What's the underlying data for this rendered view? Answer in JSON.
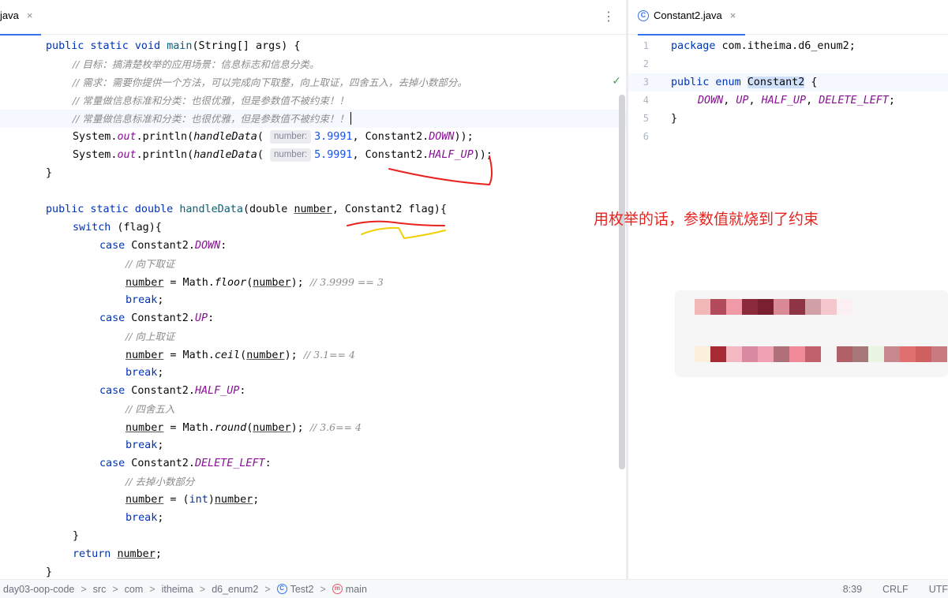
{
  "left_tab": {
    "label": "java",
    "close": "×"
  },
  "right_tab": {
    "label": "Constant2.java",
    "close": "×",
    "icon": "C"
  },
  "more_menu": "⋮",
  "inspection": "✓",
  "left_code": {
    "l1_kw": "public static void",
    "l1_name": "main",
    "l1_rest": "(String[] args) {",
    "c1": "// 目标：搞清楚枚举的应用场景：信息标志和信息分类。",
    "c2": "// 需求：需要你提供一个方法，可以完成向下取整，向上取证，四舍五入，去掉小数部分。",
    "c3": "// 常量做信息标准和分类：也很优雅，但是参数值不被约束！！",
    "c4": "// 常量做信息标准和分类：也很优雅，但是参数值不被约束！！",
    "p1_a": "System.",
    "p1_out": "out",
    "p1_b": ".println(",
    "p1_call": "handleData",
    "p1_c": "(",
    "hint": "number:",
    "p1_num": "3.9991",
    "p1_d": ", Constant2.",
    "p1_const": "DOWN",
    "p1_e": "));",
    "p2_num": "5.9991",
    "p2_const": "HALF_UP",
    "p2_e": "));",
    "brace1": "}",
    "m_kw": "public static double",
    "m_name": "handleData",
    "m_a": "(double ",
    "m_param": "number",
    "m_b": ", Constant2 flag){",
    "sw_kw": "switch",
    "sw_rest": " (flag){",
    "case_kw": "case",
    "case_pre": " Constant2.",
    "k_down": "DOWN",
    "k_up": "UP",
    "k_half": "HALF_UP",
    "k_del": "DELETE_LEFT",
    "colon": ":",
    "cm_down": "// 向下取证",
    "cm_up": "// 向上取证",
    "cm_half": "// 四舍五入",
    "cm_del": "// 去掉小数部分",
    "var": "number",
    "assign_math": " = Math.",
    "floor": "floor",
    "ceil": "ceil",
    "round": "round",
    "call_close": ");",
    "eg_floor": "// 3.9999 == 3",
    "eg_ceil": "// 3.1== 4",
    "eg_round": "// 3.6== 4",
    "assign_int_a": " = (",
    "int_kw": "int",
    "assign_int_b": ")",
    "semi": ";",
    "break_kw": "break",
    "brace2": "}",
    "ret_kw": "return",
    "ret_rest": ";"
  },
  "right_code": {
    "line_numbers": [
      "1",
      "2",
      "3",
      "4",
      "5",
      "6"
    ],
    "pkg_kw": "package",
    "pkg_rest": " com.itheima.d6_enum2;",
    "enum_kw": "public enum",
    "enum_name": "Constant2",
    "enum_brace": " {",
    "c_down": "DOWN",
    "c_up": "UP",
    "c_half": "HALF_UP",
    "c_del": "DELETE_LEFT",
    "comma": ", ",
    "end_semi": ";",
    "close": "}"
  },
  "annotation": "用枚举的话，参数值就烧到了约束",
  "statusbar": {
    "crumbs": [
      "day03-oop-code",
      "src",
      "com",
      "itheima",
      "d6_enum2",
      "Test2",
      "main"
    ],
    "sep": ">",
    "icon_class": "C",
    "icon_method": "m",
    "position": "8:39",
    "line_sep": "CRLF",
    "encoding": "UTF"
  },
  "colors": {
    "accent": "#3574f0",
    "keyword": "#0033b3",
    "constant": "#871094",
    "annotation": "#e8231e",
    "number": "#1750eb"
  }
}
